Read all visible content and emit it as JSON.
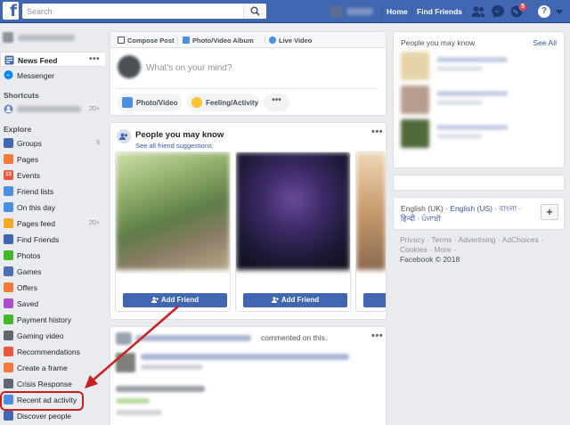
{
  "topbar": {
    "logo": "f",
    "search_placeholder": "Search",
    "nav": [
      {
        "label": "Home"
      },
      {
        "label": "Find Friends"
      }
    ],
    "notification_count": "5",
    "help_glyph": "?"
  },
  "sidebar": {
    "news_feed": "News Feed",
    "news_feed_more": "•••",
    "messenger": "Messenger",
    "shortcuts_heading": "Shortcuts",
    "shortcut_count": "20+",
    "explore_heading": "Explore",
    "items": [
      {
        "label": "Groups",
        "count": "5",
        "icon": "groups-icon",
        "color": "#4267b2"
      },
      {
        "label": "Pages",
        "count": "",
        "icon": "pages-icon",
        "color": "#f5793a"
      },
      {
        "label": "Events",
        "count": "",
        "icon": "events-icon",
        "color": "#e9573f",
        "glyph": "13"
      },
      {
        "label": "Friend lists",
        "count": "",
        "icon": "friend-lists-icon",
        "color": "#4a90e2"
      },
      {
        "label": "On this day",
        "count": "",
        "icon": "on-this-day-icon",
        "color": "#4a90e2"
      },
      {
        "label": "Pages feed",
        "count": "20+",
        "icon": "pages-feed-icon",
        "color": "#f5a623"
      },
      {
        "label": "Find Friends",
        "count": "",
        "icon": "find-friends-icon",
        "color": "#4267b2"
      },
      {
        "label": "Photos",
        "count": "",
        "icon": "photos-icon",
        "color": "#42b72a"
      },
      {
        "label": "Games",
        "count": "",
        "icon": "games-icon",
        "color": "#4b6fb5"
      },
      {
        "label": "Offers",
        "count": "",
        "icon": "offers-icon",
        "color": "#f5793a"
      },
      {
        "label": "Saved",
        "count": "",
        "icon": "saved-icon",
        "color": "#b04ad0"
      },
      {
        "label": "Payment history",
        "count": "",
        "icon": "payment-history-icon",
        "color": "#42b72a"
      },
      {
        "label": "Gaming video",
        "count": "",
        "icon": "gaming-video-icon",
        "color": "#606770"
      },
      {
        "label": "Recommendations",
        "count": "",
        "icon": "recommendations-icon",
        "color": "#e9573f"
      },
      {
        "label": "Create a frame",
        "count": "",
        "icon": "create-frame-icon",
        "color": "#f5793a"
      },
      {
        "label": "Crisis Response",
        "count": "",
        "icon": "crisis-response-icon",
        "color": "#606770"
      },
      {
        "label": "Recent ad activity",
        "count": "",
        "icon": "recent-ad-activity-icon",
        "color": "#4a90e2"
      },
      {
        "label": "Discover people",
        "count": "",
        "icon": "discover-people-icon",
        "color": "#4267b2"
      }
    ]
  },
  "composer": {
    "tabs": [
      {
        "label": "Compose Post"
      },
      {
        "label": "Photo/Video Album"
      },
      {
        "label": "Live Video"
      }
    ],
    "placeholder": "What's on your mind?",
    "actions": [
      {
        "label": "Photo/Video"
      },
      {
        "label": "Feeling/Activity"
      }
    ],
    "more": "•••"
  },
  "pymk": {
    "title": "People you may know",
    "subtitle": "See all friend suggestions",
    "more": "•••",
    "add_label": "Add Friend"
  },
  "post": {
    "commented": "commented on this.",
    "more": "•••"
  },
  "right": {
    "title": "People you may know",
    "see_all": "See All",
    "languages_current": "English (UK)",
    "languages_rest": "English (US) · বাংলা · हिन्दी · ਪੰਜਾਬੀ",
    "plus": "+",
    "footer_links": "Privacy · Terms · Advertising · AdChoices · Cookies · More ·",
    "copyright": "Facebook © 2018"
  },
  "colors": {
    "brand": "#4267b2",
    "annotation": "#cc1e1e"
  }
}
